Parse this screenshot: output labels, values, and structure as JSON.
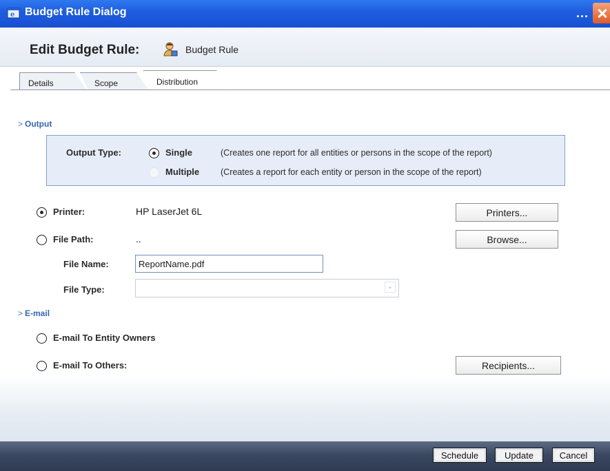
{
  "window": {
    "title": "Budget Rule Dialog",
    "more_label": "..."
  },
  "header": {
    "title": "Edit Budget Rule:",
    "subtitle": "Budget Rule"
  },
  "tabs": [
    {
      "label": "Details"
    },
    {
      "label": "Scope"
    },
    {
      "label": "Distribution"
    }
  ],
  "output": {
    "section_label": "Output",
    "type_label": "Output Type:",
    "options": [
      {
        "label": "Single",
        "description": "(Creates one report for all entities or persons in the scope of the report)",
        "selected": true
      },
      {
        "label": "Multiple",
        "description": "(Creates a report for each entity or person in the scope of the report)",
        "selected": false
      }
    ],
    "printer_label": "Printer:",
    "printer_value": "HP LaserJet 6L",
    "printers_button": "Printers...",
    "file_path_label": "File Path:",
    "file_path_value": "..",
    "browse_button": "Browse...",
    "file_name_label": "File Name:",
    "file_name_value": "ReportName.pdf",
    "file_type_label": "File Type:",
    "file_type_value": ""
  },
  "email": {
    "section_label": "E-mail",
    "to_owners_label": "E-mail To Entity Owners",
    "to_others_label": "E-mail To Others:",
    "recipients_button": "Recipients..."
  },
  "footer": {
    "schedule_button": "Schedule",
    "update_button": "Update",
    "cancel_button": "Cancel"
  },
  "colors": {
    "titlebar": "#1f5fe0",
    "section_label": "#3267b0",
    "output_box_fill": "#e7edf8",
    "footer": "#3b4861"
  },
  "icons": {
    "window": "ie-window-icon",
    "rule": "person-rule-icon",
    "close": "close-icon",
    "dropdown": "chevron-down-icon",
    "section": "chevron-right-icon"
  }
}
